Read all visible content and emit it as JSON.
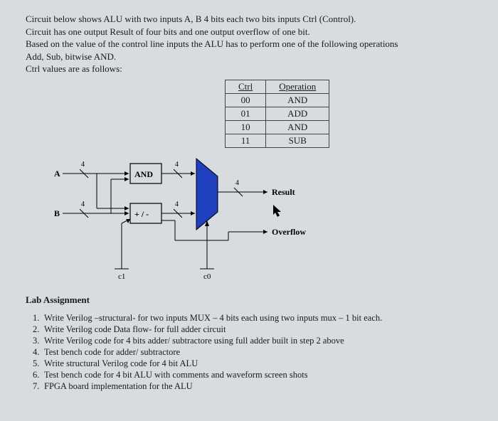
{
  "intro": {
    "line1": "Circuit below shows ALU with two inputs A, B 4 bits each two bits inputs Ctrl (Control).",
    "line2": "Circuit has one output Result of four bits and one output overflow of one bit.",
    "line3": "Based on the value of the control line inputs the ALU has to perform one of the following operations",
    "line4": "Add, Sub, bitwise AND.",
    "line5": "Ctrl values are as follows:"
  },
  "ctrl_table": {
    "headers": [
      "Ctrl",
      "Operation"
    ],
    "rows": [
      {
        "ctrl": "00",
        "op": "AND"
      },
      {
        "ctrl": "01",
        "op": "ADD"
      },
      {
        "ctrl": "10",
        "op": "AND"
      },
      {
        "ctrl": "11",
        "op": "SUB"
      }
    ]
  },
  "diagram": {
    "input_a": "A",
    "input_b": "B",
    "and_label": "AND",
    "addsub_label": "+ / -",
    "result_label": "Result",
    "overflow_label": "Overflow",
    "c1_label": "c1",
    "c0_label": "c0",
    "bus_width": "4"
  },
  "lab": {
    "title": "Lab Assignment",
    "items": [
      "Write Verilog –structural- for two inputs MUX – 4 bits each using two inputs mux – 1 bit each.",
      "Write Verilog code Data flow- for full adder circuit",
      "Write Verilog code for 4 bits adder/ subtractore using full adder built in step 2 above",
      "Test bench code for adder/ subtractore",
      "Write structural Verilog code for 4 bit ALU",
      "Test bench code for 4 bit ALU with comments and waveform screen shots",
      "FPGA board implementation for the ALU"
    ]
  }
}
